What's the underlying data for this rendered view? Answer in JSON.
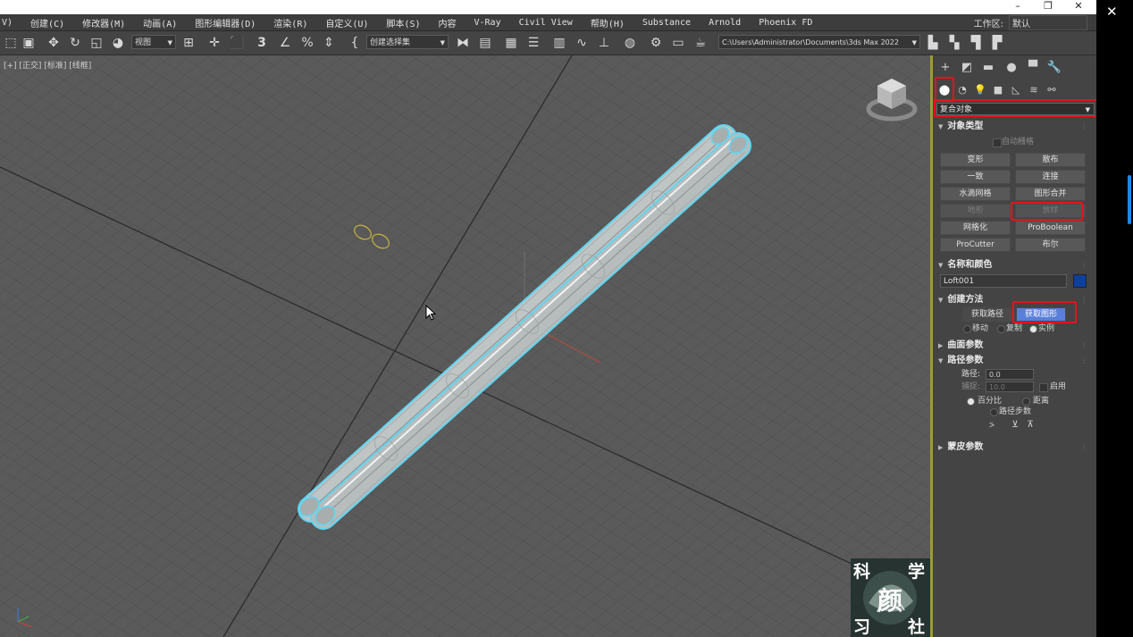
{
  "window": {
    "minimize": "–",
    "restore": "❐",
    "close": "✕"
  },
  "menu": {
    "items": [
      "V)",
      "创建(C)",
      "修改器(M)",
      "动画(A)",
      "图形编辑器(D)",
      "渲染(R)",
      "自定义(U)",
      "脚本(S)",
      "内容",
      "V-Ray",
      "Civil View",
      "帮助(H)",
      "Substance",
      "Arnold",
      "Phoenix FD"
    ],
    "workspace_label": "工作区:",
    "workspace_value": "默认"
  },
  "toolbar": {
    "view_dropdown": "视图",
    "selection_set_dropdown": "创建选择集",
    "path": "C:\\Users\\Administrator\\Documents\\3ds Max 2022"
  },
  "viewport": {
    "label": "[+] [正交] [标准] [线框]"
  },
  "logo": {
    "chars": [
      "科",
      "学",
      "颜",
      "习",
      "社"
    ]
  },
  "command_panel": {
    "category": "复合对象",
    "rollouts": {
      "object_type": {
        "title": "对象类型",
        "autogrid": "自动栅格",
        "buttons": [
          "变形",
          "散布",
          "一致",
          "连接",
          "水滴网格",
          "图形合并",
          "地形",
          "放样",
          "网格化",
          "ProBoolean",
          "ProCutter",
          "布尔"
        ]
      },
      "name_color": {
        "title": "名称和颜色",
        "name": "Loft001",
        "color": "#0d3fa0"
      },
      "creation_method": {
        "title": "创建方法",
        "get_path": "获取路径",
        "get_shape": "获取图形",
        "move": "移动",
        "copy": "复制",
        "instance": "实例"
      },
      "surface_params": {
        "title": "曲面参数"
      },
      "path_params": {
        "title": "路径参数",
        "path_label": "路径:",
        "path_value": "0.0",
        "snap_label": "捕捉:",
        "snap_value": "10.0",
        "enable": "启用",
        "percentage": "百分比",
        "distance": "距离",
        "path_steps": "路径步数"
      },
      "skin_params": {
        "title": "蒙皮参数"
      }
    }
  }
}
